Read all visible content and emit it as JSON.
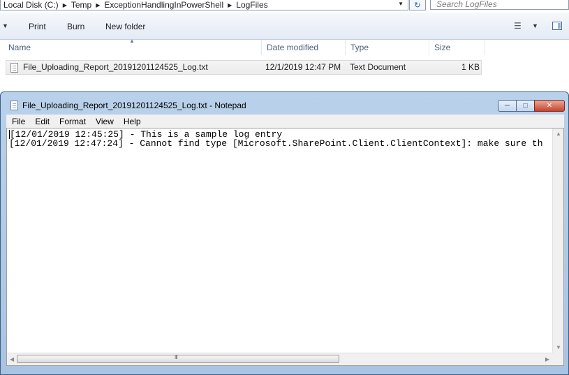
{
  "explorer": {
    "breadcrumbs": [
      "Local Disk (C:)",
      "Temp",
      "ExceptionHandlingInPowerShell",
      "LogFiles"
    ],
    "search_placeholder": "Search LogFiles",
    "toolbar": {
      "print": "Print",
      "burn": "Burn",
      "new_folder": "New folder"
    },
    "columns": {
      "name": "Name",
      "date": "Date modified",
      "type": "Type",
      "size": "Size"
    },
    "files": [
      {
        "name": "File_Uploading_Report_20191201124525_Log.txt",
        "date": "12/1/2019 12:47 PM",
        "type": "Text Document",
        "size": "1 KB"
      }
    ]
  },
  "notepad": {
    "title": "File_Uploading_Report_20191201124525_Log.txt - Notepad",
    "menu": [
      "File",
      "Edit",
      "Format",
      "View",
      "Help"
    ],
    "lines": [
      "[12/01/2019 12:45:25] - This is a sample log entry",
      "[12/01/2019 12:47:24] - Cannot find type [Microsoft.SharePoint.Client.ClientContext]: make sure th"
    ],
    "scroll_grip": "III"
  }
}
